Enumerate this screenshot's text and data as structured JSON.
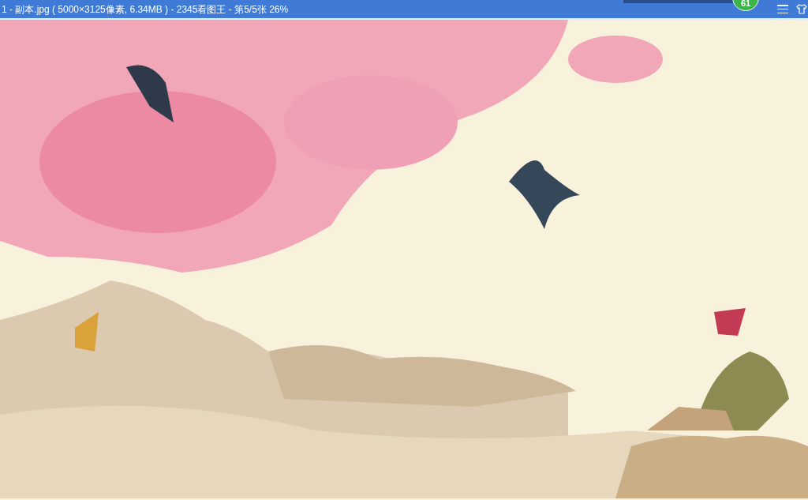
{
  "window": {
    "title": "1 - 副本.jpg ( 5000×3125像素, 6.34MB ) - 2345看图王 - 第5/5张 26%",
    "badge": "61"
  }
}
